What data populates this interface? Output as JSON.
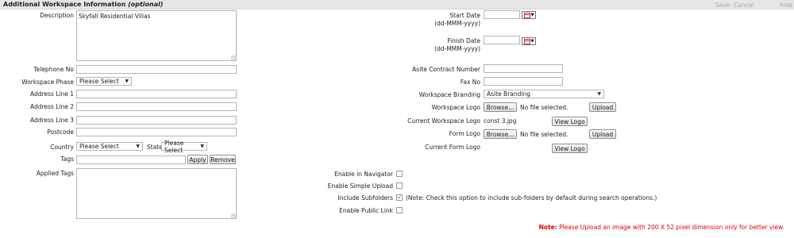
{
  "header": {
    "title": "Additional Workspace Information",
    "optional": "(optional)",
    "save": "Save",
    "cancel": "Cancel",
    "hide": "hide"
  },
  "left": {
    "description": {
      "label": "Description",
      "value": "Skyfall Residential Villas"
    },
    "telephone": {
      "label": "Telephone No",
      "value": ""
    },
    "phase": {
      "label": "Workspace Phase",
      "value": "Please Select"
    },
    "address1": {
      "label": "Address Line 1",
      "value": ""
    },
    "address2": {
      "label": "Address Line 2",
      "value": ""
    },
    "address3": {
      "label": "Address Line 3",
      "value": ""
    },
    "postcode": {
      "label": "Postcode",
      "value": ""
    },
    "country": {
      "label": "Country",
      "value": "Please Select"
    },
    "state": {
      "label": "State",
      "value": "Please Select"
    },
    "tags": {
      "label": "Tags",
      "value": "",
      "apply": "Apply",
      "remove": "Remove"
    },
    "applied_tags": {
      "label": "Applied Tags",
      "value": ""
    }
  },
  "right": {
    "start_date": {
      "label": "Start Date",
      "hint": "(dd-MMM-yyyy)",
      "value": ""
    },
    "finish_date": {
      "label": "Finish Date",
      "hint": "(dd-MMM-yyyy)",
      "value": ""
    },
    "contract_number": {
      "label": "Asite Contract Number",
      "value": ""
    },
    "fax": {
      "label": "Fax No",
      "value": ""
    },
    "branding": {
      "label": "Workspace Branding",
      "value": "Asite Branding"
    },
    "workspace_logo": {
      "label": "Workspace Logo",
      "browse": "Browse...",
      "status": "No file selected.",
      "upload": "Upload"
    },
    "current_workspace_logo": {
      "label": "Current Workspace Logo",
      "value": "const 3.jpg",
      "view": "View Logo"
    },
    "form_logo": {
      "label": "Form Logo",
      "browse": "Browse...",
      "status": "No file selected.",
      "upload": "Upload"
    },
    "current_form_logo": {
      "label": "Current Form Logo",
      "view": "View Logo"
    }
  },
  "options": {
    "navigator": {
      "label": "Enable in Navigator",
      "checked": false
    },
    "simple_upload": {
      "label": "Enable Simple Upload",
      "checked": false
    },
    "subfolders": {
      "label": "Include Subfolders",
      "checked": true,
      "note": "(Note: Check this option to include sub-folders by default during search operations.)"
    },
    "public_link": {
      "label": "Enable Public Link",
      "checked": false
    }
  },
  "footer": {
    "note_prefix": "Note:",
    "note_text": "Please Upload an image with 200 X 52 pixel dimension only for better view."
  },
  "colors": {
    "header_bg": "#e6e6e6",
    "note": "#e00000",
    "check": "#1f5fa8"
  },
  "icons": {
    "calendar": "calendar-icon",
    "dropdown": "chevron-down-icon",
    "check": "checkmark-icon"
  }
}
